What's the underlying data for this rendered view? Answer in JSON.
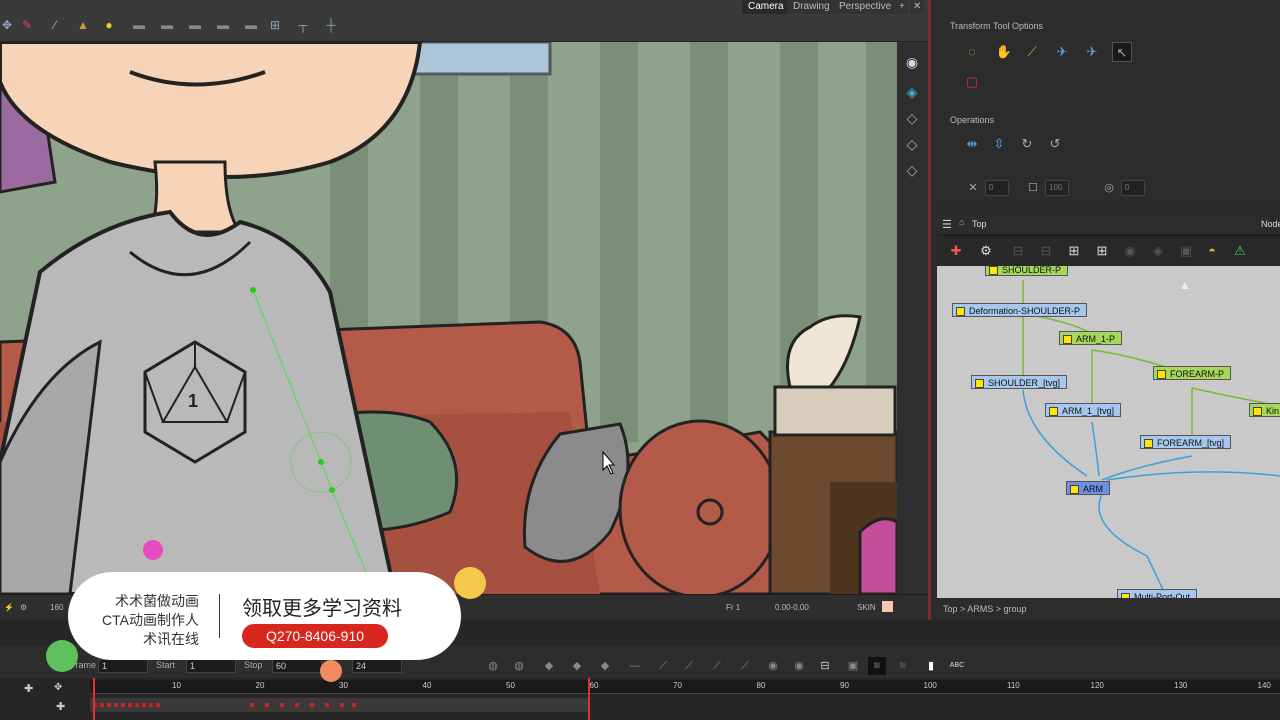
{
  "viewport_tabs": [
    "Camera",
    "Drawing",
    "Perspective"
  ],
  "active_view_tab": "Camera",
  "tool_options": {
    "title": "Transform Tool Options",
    "operations_label": "Operations",
    "fields": [
      "0",
      "100",
      "0"
    ]
  },
  "node_view": {
    "home_label": "Top",
    "tab_label": "Node",
    "nodes": [
      {
        "label": "SHOULDER-P",
        "kind": "green"
      },
      {
        "label": "Deformation-SHOULDER-P",
        "kind": "blue"
      },
      {
        "label": "ARM_1-P",
        "kind": "green"
      },
      {
        "label": "FOREARM-P",
        "kind": "green"
      },
      {
        "label": "SHOULDER_[tvg]",
        "kind": "blue"
      },
      {
        "label": "ARM_1_[tvg]",
        "kind": "blue"
      },
      {
        "label": "FOREARM_[tvg]",
        "kind": "blue"
      },
      {
        "label": "Kin",
        "kind": "green"
      },
      {
        "label": "ARM",
        "kind": "peg"
      },
      {
        "label": "Multi-Port-Out",
        "kind": "blue"
      }
    ],
    "breadcrumb": "Top  >  ARMS  >  group"
  },
  "viewport_status": {
    "zoom": "160",
    "frame": "Fr 1",
    "coords": "0.00-0.00",
    "layer": "SKIN"
  },
  "timeline": {
    "frame_label": "Frame",
    "frame_value": "1",
    "start_label": "Start",
    "start_value": "1",
    "stop_label": "Stop",
    "stop_value": "60",
    "fps_value": "24",
    "ticks": [
      "10",
      "20",
      "30",
      "40",
      "50",
      "60",
      "70",
      "80",
      "90",
      "100",
      "110",
      "120",
      "130",
      "140"
    ]
  },
  "promo": {
    "line1": "术术菌做动画",
    "line2": "CTA动画制作人",
    "line3": "术讯在线",
    "title": "领取更多学习资料",
    "badge": "Q270-8406-910"
  },
  "artwork": {
    "die_number": "1"
  }
}
